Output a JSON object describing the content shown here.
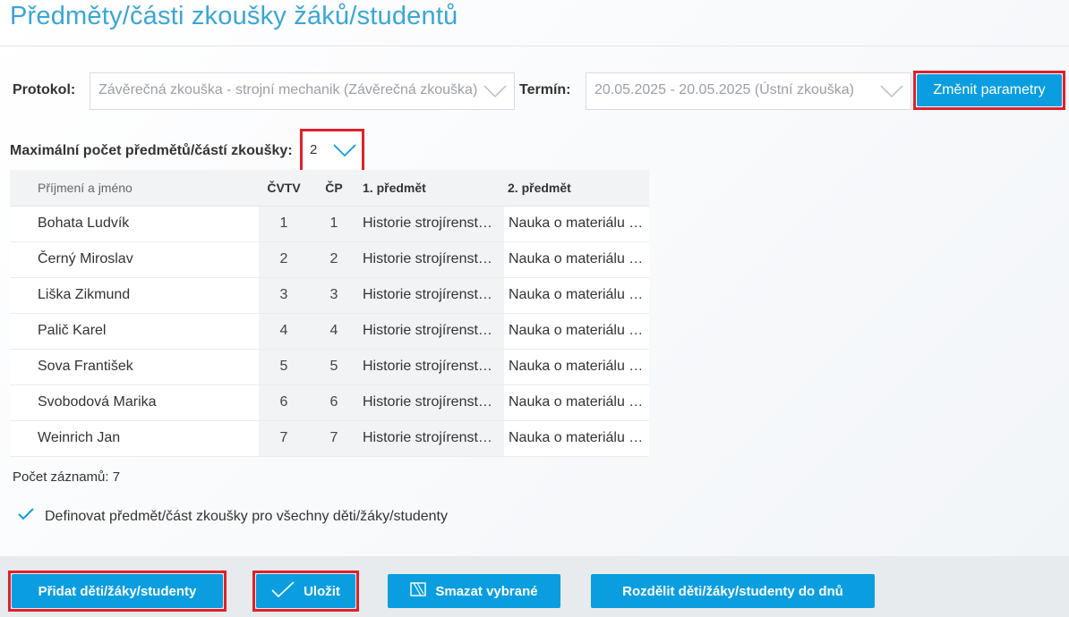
{
  "page": {
    "title": "Předměty/části zkoušky žáků/studentů"
  },
  "params": {
    "protocol_label": "Protokol:",
    "protocol_value": "Závěrečná zkouška - strojní mechanik (Závěrečná zkouška)",
    "term_label": "Termín:",
    "term_value": "20.05.2025 - 20.05.2025 (Ústní zkouška)",
    "change_button": "Změnit parametry"
  },
  "max_subjects": {
    "label": "Maximální počet předmětů/částí zkoušky:",
    "value": "2"
  },
  "table": {
    "headers": {
      "name": "Příjmení a jméno",
      "cvtv": "ČVTV",
      "cp": "ČP",
      "subject1": "1. předmět",
      "subject2": "2. předmět"
    },
    "rows": [
      {
        "name": "Bohata Ludvík",
        "cvtv": "1",
        "cp": "1",
        "subject1": "Historie strojírenst…",
        "subject2": "Nauka o materiálu …"
      },
      {
        "name": "Černý Miroslav",
        "cvtv": "2",
        "cp": "2",
        "subject1": "Historie strojírenst…",
        "subject2": "Nauka o materiálu …"
      },
      {
        "name": "Liška Zikmund",
        "cvtv": "3",
        "cp": "3",
        "subject1": "Historie strojírenst…",
        "subject2": "Nauka o materiálu …"
      },
      {
        "name": "Palič Karel",
        "cvtv": "4",
        "cp": "4",
        "subject1": "Historie strojírenst…",
        "subject2": "Nauka o materiálu …"
      },
      {
        "name": "Sova František",
        "cvtv": "5",
        "cp": "5",
        "subject1": "Historie strojírenst…",
        "subject2": "Nauka o materiálu …"
      },
      {
        "name": "Svobodová Marika",
        "cvtv": "6",
        "cp": "6",
        "subject1": "Historie strojírenst…",
        "subject2": "Nauka o materiálu …"
      },
      {
        "name": "Weinrich Jan",
        "cvtv": "7",
        "cp": "7",
        "subject1": "Historie strojírenst…",
        "subject2": "Nauka o materiálu …"
      }
    ]
  },
  "record_count": "Počet záznamů: 7",
  "define_all": {
    "label": "Definovat předmět/část zkoušky pro všechny děti/žáky/studenty",
    "checked": true
  },
  "footer": {
    "add_button": "Přidat děti/žáky/studenty",
    "save_button": "Uložit",
    "delete_button": "Smazat vybrané",
    "split_button": "Rozdělit děti/žáky/studenty do dnů"
  },
  "colors": {
    "accent": "#0a9ee0",
    "title": "#3aa6d6",
    "highlight": "#e0202a"
  }
}
